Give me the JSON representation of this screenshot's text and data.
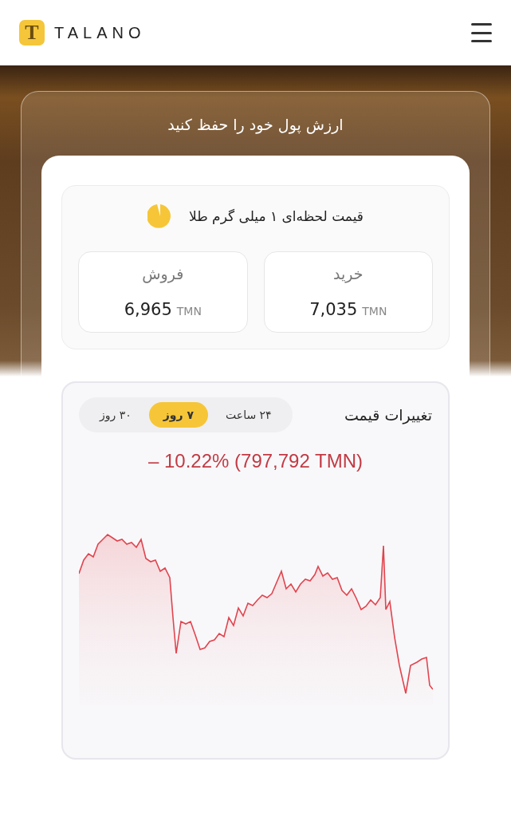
{
  "header": {
    "brand": "TALANO",
    "logo_letter": "T"
  },
  "hero": {
    "title": "ارزش پول خود را حفظ کنید"
  },
  "live_price": {
    "title": "قیمت لحظه‌ای ۱ میلی گرم طلا",
    "quotes": [
      {
        "label": "خرید",
        "value": "7,035",
        "unit": "TMN"
      },
      {
        "label": "فروش",
        "value": "6,965",
        "unit": "TMN"
      }
    ]
  },
  "price_change": {
    "title": "تغییرات قیمت",
    "tabs": [
      {
        "label": "۲۴ ساعت",
        "selected": false
      },
      {
        "label": "۷ روز",
        "selected": true
      },
      {
        "label": "۳۰ روز",
        "selected": false
      }
    ],
    "change": "– 10.22% (797,792 TMN)"
  }
}
